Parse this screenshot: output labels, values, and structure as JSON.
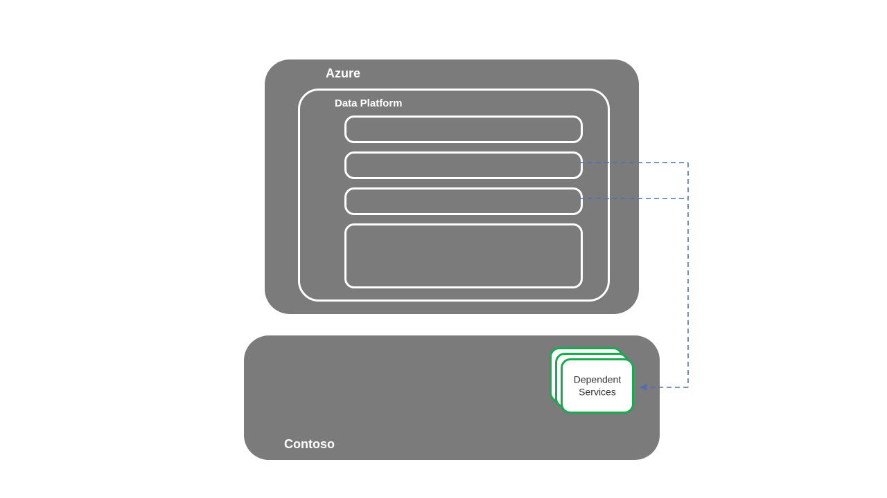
{
  "azure": {
    "label": "Azure",
    "data_platform_label": "Data Platform"
  },
  "contoso": {
    "label": "Contoso",
    "dependent_services_label": "Dependent\nServices"
  },
  "colors": {
    "container_fill": "#7b7b7b",
    "outline_white": "#ffffff",
    "card_border_green": "#17ab4f",
    "connector_blue": "#4f6fb3"
  }
}
